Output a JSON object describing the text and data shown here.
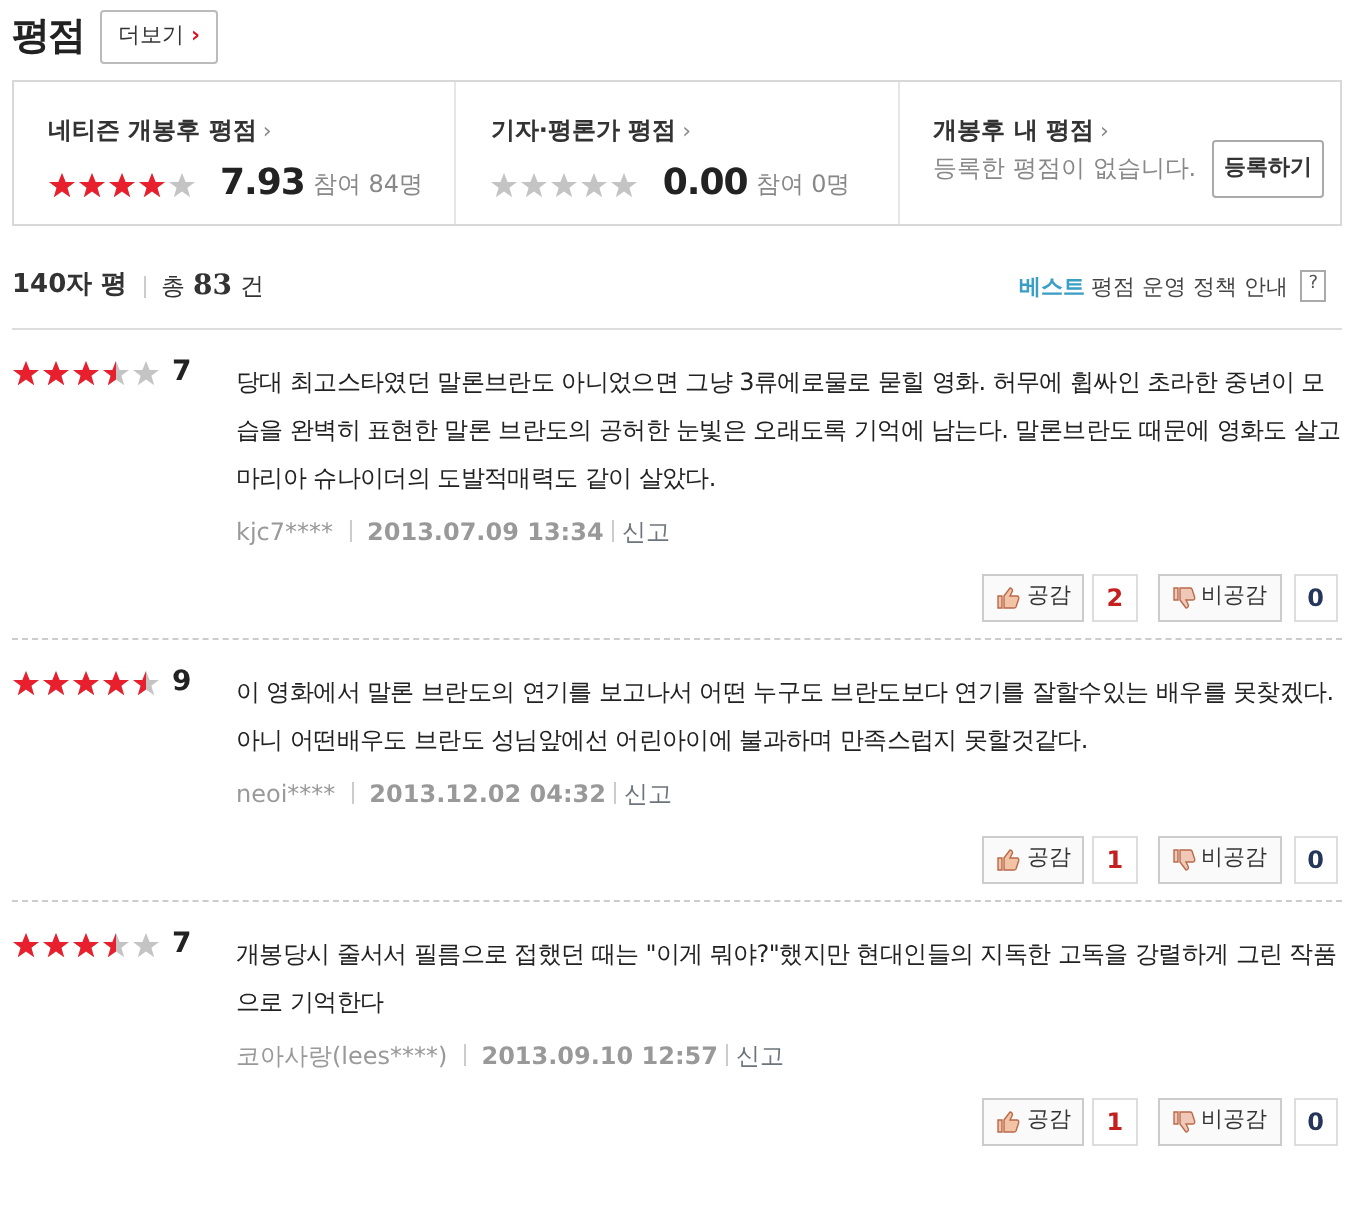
{
  "header": {
    "title": "평점",
    "more_button": "더보기",
    "more_arrow": "›"
  },
  "summary": [
    {
      "title": "네티즌 개봉후 평점",
      "arrow": "›",
      "kind": "score",
      "stars": 4,
      "score": "7.93",
      "participants": "참여 84명"
    },
    {
      "title": "기자·평론가 평점",
      "arrow": "›",
      "kind": "score",
      "stars": 0,
      "score": "0.00",
      "participants": "참여 0명"
    },
    {
      "title": "개봉후 내 평점",
      "arrow": "›",
      "kind": "mine",
      "message": "등록한 평점이 없습니다.",
      "button": "등록하기"
    }
  ],
  "list_header": {
    "label": "140자 평",
    "total_prefix": "총",
    "total": "83",
    "total_suffix": "건",
    "best": "베스트",
    "policy": "평점 운영 정책 안내",
    "help": "?"
  },
  "reviews": [
    {
      "stars": 3.5,
      "score": "7",
      "text": "당대 최고스타였던 말론브란도 아니었으면 그냥 3류에로물로 묻힐 영화. 허무에 휩싸인 초라한 중년이 모습을 완벽히 표현한 말론 브란도의 공허한 눈빛은 오래도록 기억에 남는다. 말론브란도 때문에 영화도 살고 마리아 슈나이더의 도발적매력도 같이 살았다.",
      "user": "kjc7****",
      "date": "2013.07.09 13:34",
      "report": "신고",
      "like": "공감",
      "like_count": "2",
      "dislike": "비공감",
      "dislike_count": "0"
    },
    {
      "stars": 4.5,
      "score": "9",
      "text": "이 영화에서 말론 브란도의 연기를 보고나서 어떤 누구도 브란도보다 연기를 잘할수있는 배우를 못찾겠다. 아니 어떤배우도 브란도 성님앞에선 어린아이에 불과하며 만족스럽지 못할것같다.",
      "user": "neoi****",
      "date": "2013.12.02 04:32",
      "report": "신고",
      "like": "공감",
      "like_count": "1",
      "dislike": "비공감",
      "dislike_count": "0"
    },
    {
      "stars": 3.5,
      "score": "7",
      "text": "개봉당시 줄서서 필름으로 접했던 때는 \"이게 뭐야?\"했지만 현대인들의 지독한 고독을 강렬하게 그린 작품으로 기억한다",
      "user": "코아사랑(lees****)",
      "date": "2013.09.10 12:57",
      "report": "신고",
      "like": "공감",
      "like_count": "1",
      "dislike": "비공감",
      "dislike_count": "0"
    }
  ]
}
